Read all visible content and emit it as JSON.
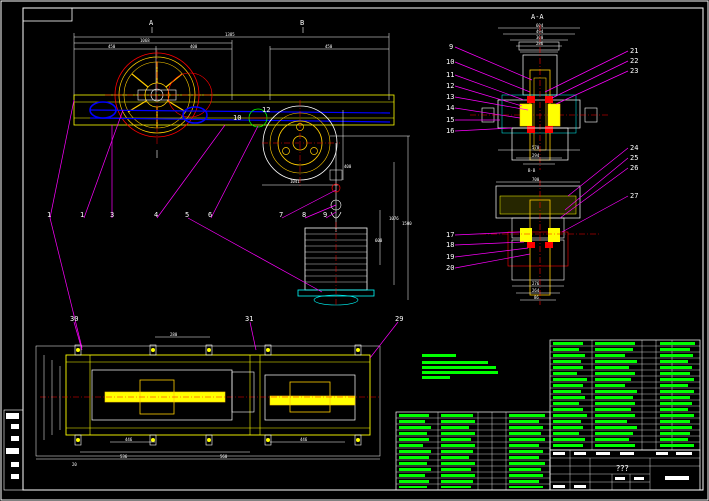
{
  "view_labels": {
    "section_a": "A-A",
    "section_b": "B-B",
    "marker_a": "A",
    "marker_b": "B"
  },
  "callouts": {
    "main": [
      "1",
      "1",
      "3",
      "4",
      "5",
      "6",
      "7",
      "8",
      "9"
    ],
    "side": [
      "9",
      "10",
      "11",
      "12",
      "13",
      "14",
      "15",
      "16",
      "21",
      "22",
      "23",
      "24",
      "25",
      "26",
      "27",
      "17",
      "18",
      "19",
      "20"
    ],
    "plan": [
      "30",
      "31",
      "29"
    ]
  },
  "title_block": {
    "drawing_title": "???"
  },
  "colors": {
    "outline": "#ffffff",
    "frame": "#ffff00",
    "dimension": "#00ffff",
    "leader": "#ff00ff",
    "centerline": "#ff0000",
    "belt": "#0000ff",
    "table_text": "#00ff00",
    "weld": "#ffcc00"
  }
}
